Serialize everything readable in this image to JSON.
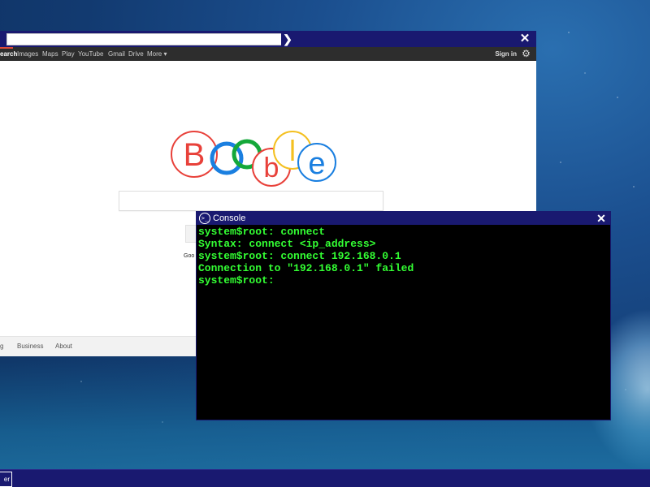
{
  "browser": {
    "url_value": "",
    "go_icon": "chevron-right-icon",
    "close_label": "✕",
    "nav": {
      "items": [
        "earch",
        "Images",
        "Maps",
        "Play",
        "YouTube",
        "Gmail",
        "Drive",
        "More ▾"
      ],
      "sign_in": "Sign in"
    },
    "logo_letters": [
      "B",
      "",
      "",
      "b",
      "l",
      "e"
    ],
    "lang_partial": "Goo",
    "footer_links": [
      "g",
      "Business",
      "About"
    ]
  },
  "console": {
    "title": "Console",
    "icon_glyph": ">_",
    "close_label": "✕",
    "lines": [
      "system$root: connect",
      "Syntax: connect <ip_address>",
      "system$root: connect 192.168.0.1",
      "Connection to \"192.168.0.1\" failed",
      "system$root:"
    ]
  },
  "taskbar": {
    "start_label": "er"
  },
  "colors": {
    "titlebar": "#191970",
    "console_text": "#33ff33",
    "logo_red": "#e8413a",
    "logo_blue": "#1a7fe0",
    "logo_green": "#14a83a",
    "logo_yellow": "#f4c020"
  }
}
